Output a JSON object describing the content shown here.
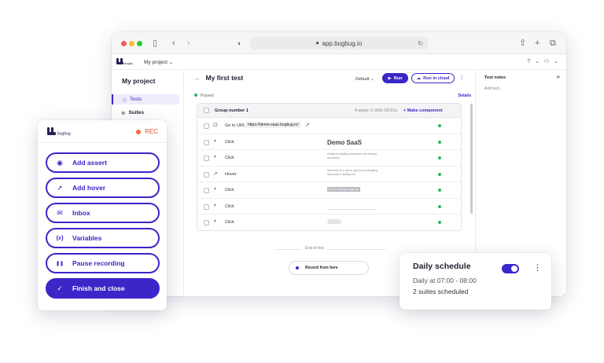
{
  "browser": {
    "url": "app.bugbug.io",
    "project_switch": "My project ⌄",
    "appbar_right": "? ⌄  ⚇ ⌄"
  },
  "sidebar": {
    "project_title": "My project",
    "items": [
      {
        "label": "Tests",
        "icon": "diamond-icon",
        "active": true
      },
      {
        "label": "Suites",
        "icon": "stack-icon",
        "active": false
      }
    ]
  },
  "test": {
    "title": "My first test",
    "profile": "Default ⌄",
    "run_label": "Run",
    "cloud_label": "Run in cloud",
    "status": "Passed",
    "details": "Details",
    "group": {
      "name": "Group number 1",
      "meta": "4 steps  ⊙ 00m 03.61s",
      "add": "+ Make component"
    },
    "steps": [
      {
        "icon": "browser-icon",
        "action": "Go to URL",
        "url": "https://demo-saas.bugbug.io/"
      },
      {
        "icon": "mouse-icon",
        "action": "Click"
      },
      {
        "icon": "mouse-icon",
        "action": "Click"
      },
      {
        "icon": "cursor-icon",
        "action": "Hover"
      },
      {
        "icon": "mouse-icon",
        "action": "Click"
      },
      {
        "icon": "mouse-icon",
        "action": "Click"
      },
      {
        "icon": "mouse-icon",
        "action": "Click"
      }
    ],
    "thumb_title": "Demo SaaS",
    "thumb_text": "Practice building automated test testing scenarios",
    "thumb_text2": "Welcome to a demo app for pra BugBug automation testing tool",
    "thumb_btn": "Go to example sign-up",
    "end_label": "End of test",
    "record_label": "Record from here"
  },
  "notes": {
    "title": "Test notes",
    "placeholder": "Add text..."
  },
  "recorder": {
    "state": "REC",
    "buttons": [
      {
        "label": "Add assert",
        "icon": "eye-icon",
        "glyph": "◉"
      },
      {
        "label": "Add hover",
        "icon": "pointer-icon",
        "glyph": "➚"
      },
      {
        "label": "Inbox",
        "icon": "mail-icon",
        "glyph": "✉"
      },
      {
        "label": "Variables",
        "icon": "braces-icon",
        "glyph": "{x}"
      },
      {
        "label": "Pause recording",
        "icon": "pause-icon",
        "glyph": "❚❚"
      },
      {
        "label": "Finish and close",
        "icon": "check-icon",
        "glyph": "✓"
      }
    ]
  },
  "schedule": {
    "title": "Daily schedule",
    "time": "Daily at 07:00 - 08:00",
    "count": "2 suites scheduled",
    "enabled": true
  },
  "colors": {
    "accent": "#3b26c8",
    "passed": "#2db465",
    "rec": "#f06d3a"
  }
}
